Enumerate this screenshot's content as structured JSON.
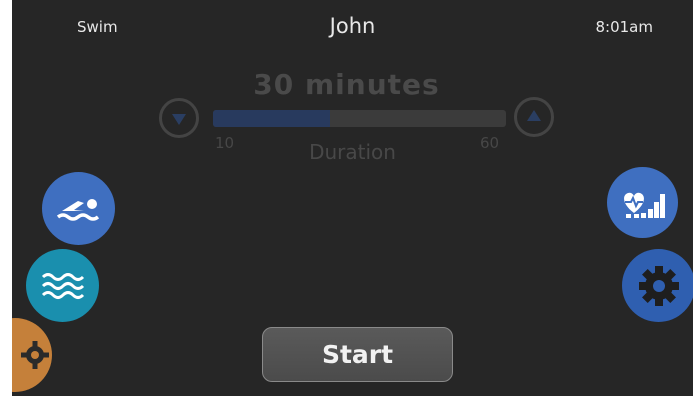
{
  "status_bar": {
    "mode": "Swim",
    "user": "John",
    "time": "8:01am"
  },
  "duration": {
    "display": "30 minutes",
    "label": "Duration",
    "min_label": "10",
    "max_label": "60",
    "level": 0.4
  },
  "start_button": {
    "label": "Start"
  },
  "icons": {
    "left": [
      "swimmer-icon",
      "water-waves-icon",
      "settings-gear-icon"
    ],
    "right": [
      "heart-rate-levels-icon",
      "settings-gear-icon"
    ],
    "stepper": [
      "decrease-arrow-icon",
      "increase-arrow-icon"
    ]
  },
  "colors": {
    "background": "#262626",
    "swim_blue": "#3f6fc0",
    "water_teal": "#1a8fae",
    "orange": "#c5803a",
    "slider_fill": "#283a5e"
  }
}
